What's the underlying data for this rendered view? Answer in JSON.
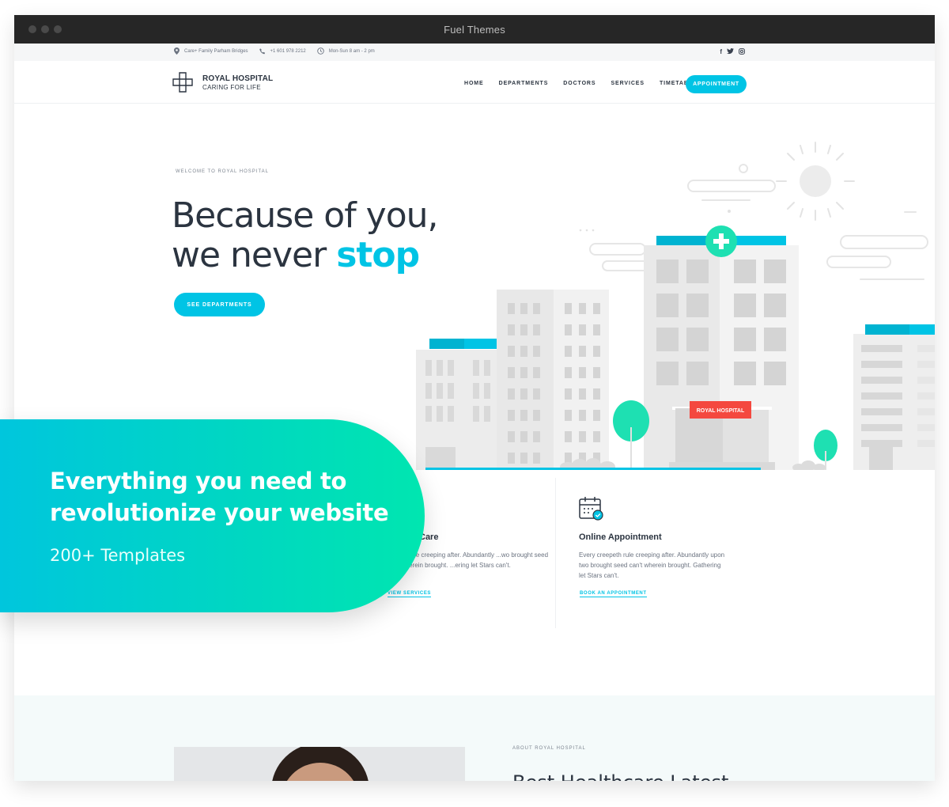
{
  "window": {
    "title": "Fuel Themes"
  },
  "infobar": {
    "address": "Care+ Family Parham Bridges",
    "phone": "+1 601 978 2212",
    "hours": "Mon-Sun 8 am - 2 pm",
    "social": [
      "f",
      "t",
      "i"
    ]
  },
  "brand": {
    "name": "ROYAL HOSPITAL",
    "tagline": "CARING FOR LIFE"
  },
  "nav": {
    "items": [
      "HOME",
      "DEPARTMENTS",
      "DOCTORS",
      "SERVICES",
      "TIMETABLE"
    ],
    "cta": "APPOINTMENT"
  },
  "hero": {
    "eyebrow": "WELCOME TO ROYAL HOSPITAL",
    "line1": "Because of you,",
    "line2_prefix": "we never ",
    "line2_accent": "stop",
    "cta": "SEE DEPARTMENTS",
    "sign": "ROYAL HOSPITAL"
  },
  "features": [
    {
      "title": "Care",
      "text": "...epeth rule creeping after. Abundantly ...wo brought seed can't wherein brought. ...ering let Stars can't.",
      "link": "VIEW SERVICES"
    },
    {
      "title": "Online Appointment",
      "text": "Every creepeth rule creeping after. Abundantly upon two brought seed can't wherein brought. Gathering let Stars can't.",
      "link": "BOOK AN APPOINTMENT"
    }
  ],
  "about": {
    "eyebrow": "ABOUT ROYAL HOSPITAL",
    "title": "Best Healthcare Latest"
  },
  "promo": {
    "headline": "Everything you need to revolutionize your website",
    "sub": "200+ Templates"
  },
  "colors": {
    "accent": "#00c4e5",
    "promo_start": "#00c6dd",
    "promo_end": "#00e6b0",
    "sign_red": "#f4483f",
    "tree": "#1ee0b2"
  }
}
